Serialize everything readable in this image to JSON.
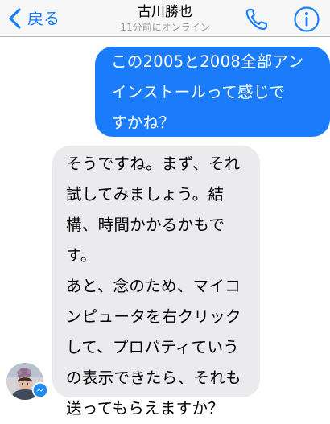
{
  "navbar": {
    "back_label": "戻る",
    "contact_name": "古川勝也",
    "contact_status": "11分前にオンライン",
    "phone_icon": "phone-icon",
    "info_icon": "info-icon"
  },
  "messages": {
    "outgoing": {
      "lines": [
        "この2005と2008全部アン",
        "インストールって感じで",
        "すかね？"
      ]
    },
    "incoming": {
      "lines": [
        "そうですね。まず、それ",
        "試してみましょう。結",
        "構、時間かかるかもで",
        "す。",
        "あと、念のため、マイコ",
        "ンピュータを右クリック",
        "して、プロパティていう",
        "の表示できたら、それも",
        "送ってもらえますか？"
      ]
    }
  },
  "colors": {
    "accent": "#1a7ffb",
    "outgoing_bubble": "#1a7cfa",
    "incoming_bubble": "#ebebee",
    "messenger_badge": "#1f8bf3"
  }
}
